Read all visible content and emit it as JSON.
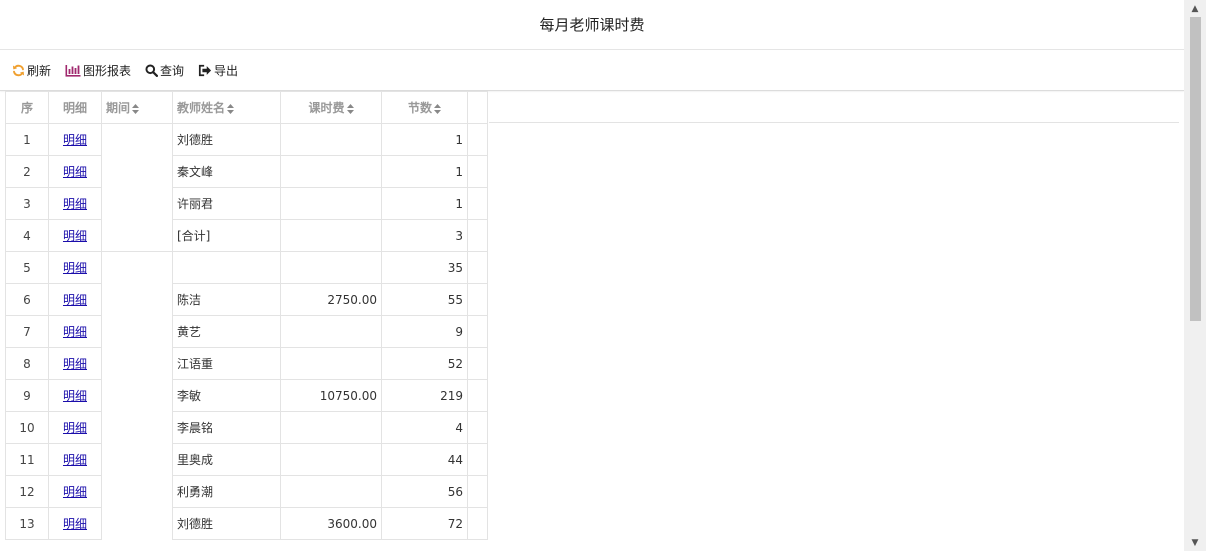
{
  "title": "每月老师课时费",
  "toolbar": {
    "refresh": "刷新",
    "chart_report": "图形报表",
    "query": "查询",
    "export": "导出"
  },
  "columns": {
    "index": "序",
    "detail": "明细",
    "period": "期间",
    "teacher": "教师姓名",
    "fee": "课时费",
    "sessions": "节数"
  },
  "rows": [
    {
      "index": "1",
      "detail": "明细",
      "teacher": "刘德胜",
      "fee": "",
      "sessions": "1"
    },
    {
      "index": "2",
      "detail": "明细",
      "teacher": "秦文峰",
      "fee": "",
      "sessions": "1"
    },
    {
      "index": "3",
      "detail": "明细",
      "teacher": "许丽君",
      "fee": "",
      "sessions": "1"
    },
    {
      "index": "4",
      "detail": "明细",
      "teacher": "[合计]",
      "fee": "",
      "sessions": "3"
    },
    {
      "index": "5",
      "detail": "明细",
      "teacher": "",
      "fee": "",
      "sessions": "35"
    },
    {
      "index": "6",
      "detail": "明细",
      "teacher": "陈洁",
      "fee": "2750.00",
      "sessions": "55"
    },
    {
      "index": "7",
      "detail": "明细",
      "teacher": "黄艺",
      "fee": "",
      "sessions": "9"
    },
    {
      "index": "8",
      "detail": "明细",
      "teacher": "江语重",
      "fee": "",
      "sessions": "52"
    },
    {
      "index": "9",
      "detail": "明细",
      "teacher": "李敏",
      "fee": "10750.00",
      "sessions": "219"
    },
    {
      "index": "10",
      "detail": "明细",
      "teacher": "李晨铭",
      "fee": "",
      "sessions": "4"
    },
    {
      "index": "11",
      "detail": "明细",
      "teacher": "里奥成",
      "fee": "",
      "sessions": "44"
    },
    {
      "index": "12",
      "detail": "明细",
      "teacher": "利勇潮",
      "fee": "",
      "sessions": "56"
    },
    {
      "index": "13",
      "detail": "明细",
      "teacher": "刘德胜",
      "fee": "3600.00",
      "sessions": "72"
    }
  ],
  "icons": {
    "refresh": "refresh-icon",
    "chart": "bar-chart-icon",
    "query": "search-icon",
    "export": "export-icon"
  },
  "colors": {
    "refresh_icon": "#f0a030",
    "chart_icon": "#a0286e",
    "link": "#1a0dab"
  }
}
